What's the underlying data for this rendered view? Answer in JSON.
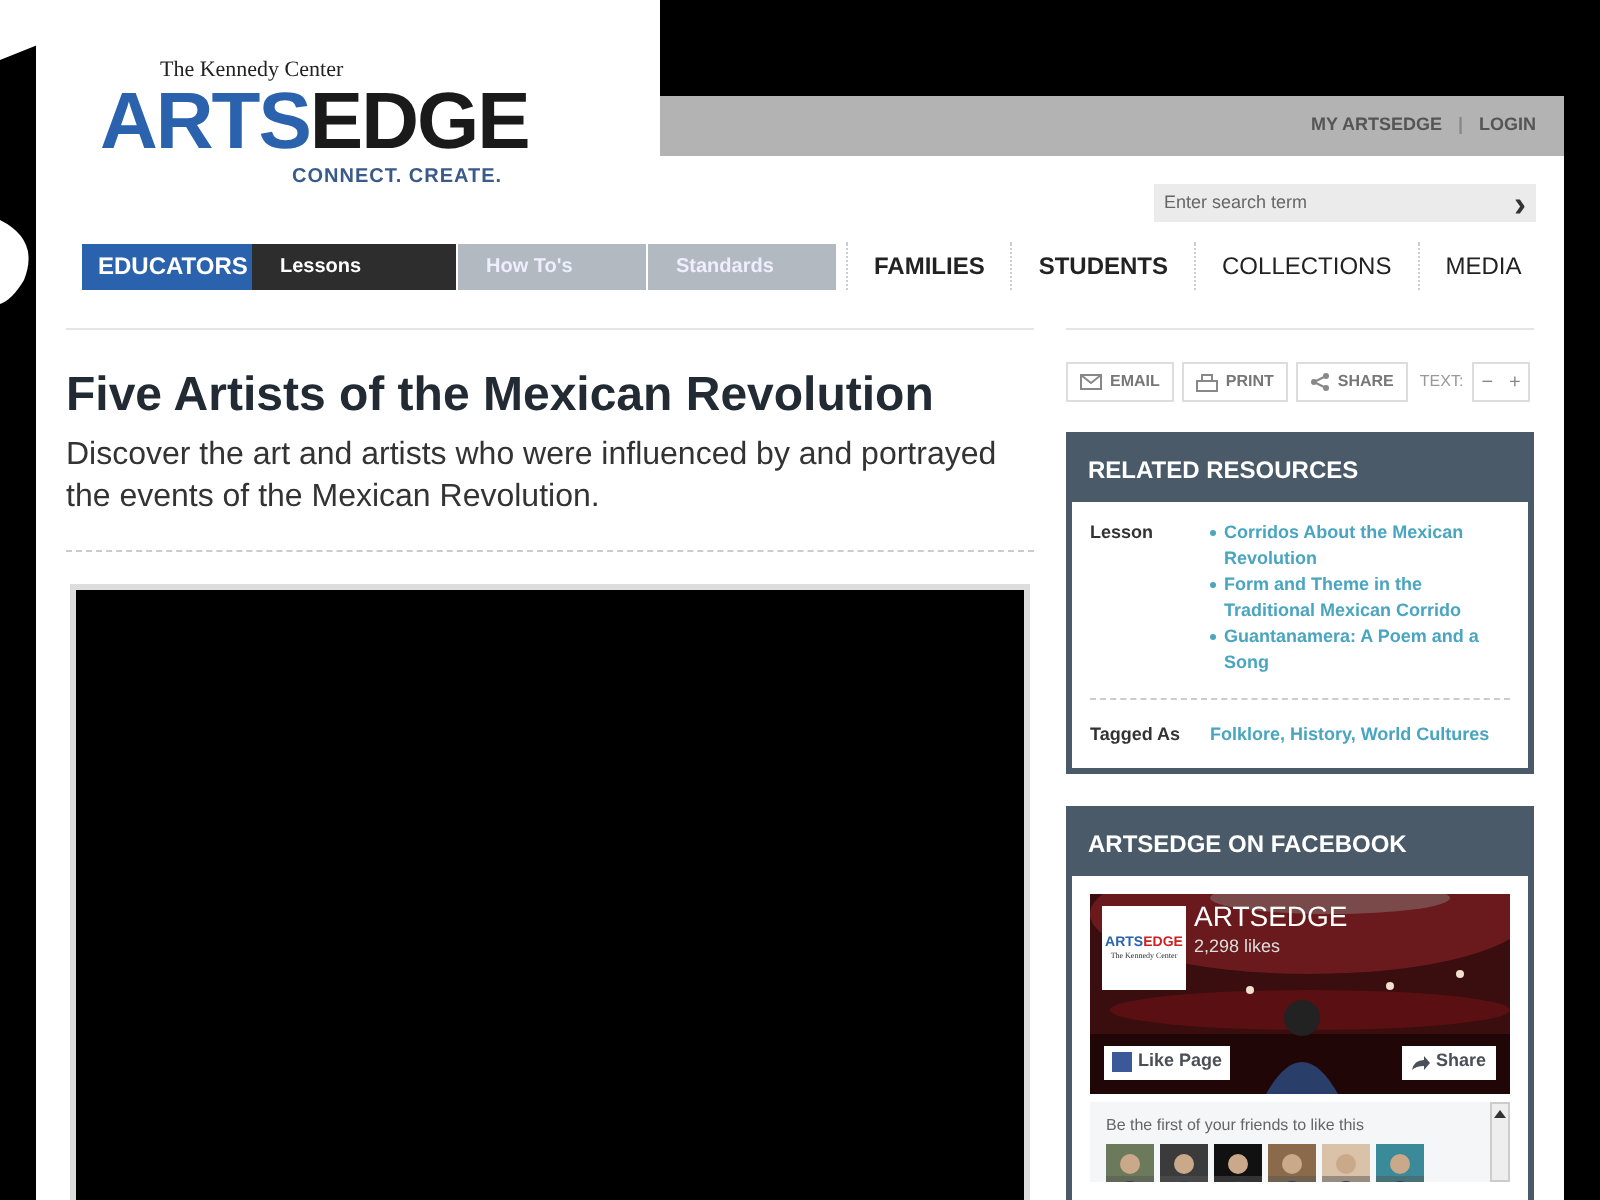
{
  "logo": {
    "org": "The Kennedy Center",
    "word_1": "ARTS",
    "word_2": "EDGE",
    "tagline": "CONNECT. CREATE."
  },
  "top_links": [
    "MY ARTSEDGE",
    "|",
    "LOGIN"
  ],
  "search": {
    "placeholder": "Enter search term",
    "button": "›"
  },
  "educators_nav": {
    "label": "EDUCATORS",
    "items": [
      {
        "label": "Lessons",
        "selected": true
      },
      {
        "label": "How To's",
        "selected": false
      },
      {
        "label": "Standards",
        "selected": false
      }
    ]
  },
  "main_nav": [
    {
      "label": "FAMILIES",
      "kind": "audience"
    },
    {
      "label": "STUDENTS",
      "kind": "audience"
    },
    {
      "label": "COLLECTIONS",
      "kind": "section"
    },
    {
      "label": "MEDIA",
      "kind": "section"
    }
  ],
  "article": {
    "title": "Five Artists of the Mexican Revolution",
    "summary": "Discover the art and artists who were influenced by and portrayed the events of the Mexican Revolution."
  },
  "share_tools": [
    {
      "label": "EMAIL",
      "kind": "email"
    },
    {
      "label": "PRINT",
      "kind": "print"
    },
    {
      "label": "SHARE",
      "kind": "share"
    }
  ],
  "text_size": {
    "label": "TEXT:",
    "decrease": "−",
    "increase": "+"
  },
  "related": {
    "title": "RELATED RESOURCES",
    "lesson_label": "Lesson",
    "lessons": [
      "Corridos About the Mexican Revolution",
      "Form and Theme in the Traditional Mexican Corrido",
      "Guantanamera: A Poem and a Song"
    ],
    "tagged_label": "Tagged As",
    "tags": "Folklore, History, World Cultures"
  },
  "facebook": {
    "title": "ARTSEDGE ON FACEBOOK",
    "page_name": "ARTSEDGE",
    "likes": "2,298 likes",
    "avatar_logo": {
      "word_1": "ARTS",
      "word_2": "EDGE",
      "subtitle": "The Kennedy Center"
    },
    "like_button": "Like Page",
    "share_button": "Share",
    "friends_text": "Be the first of your friends to like this"
  }
}
